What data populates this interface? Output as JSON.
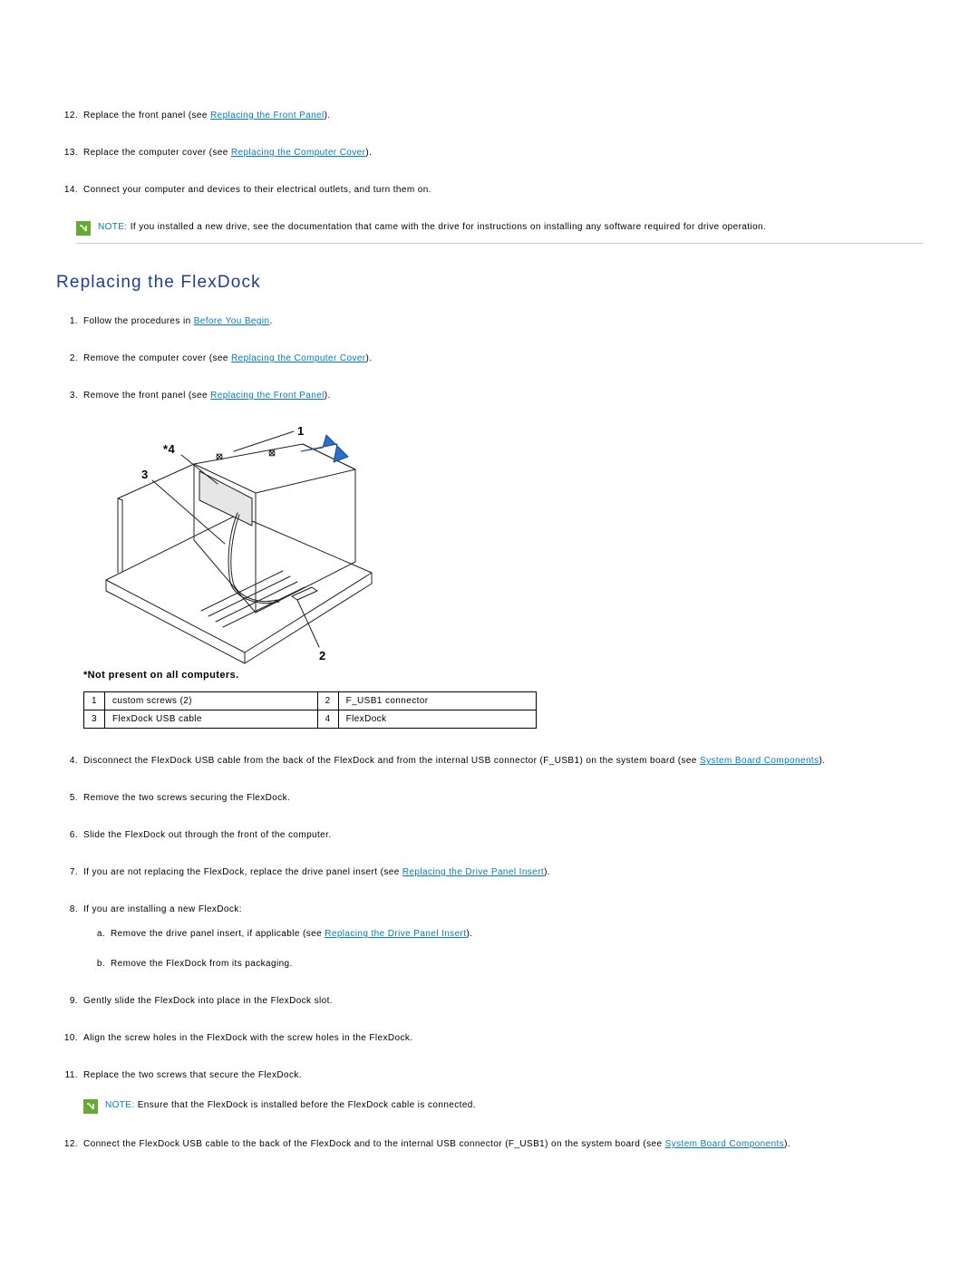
{
  "top_steps": [
    {
      "num": "12.",
      "prefix": "Replace the front panel (see ",
      "link": "Replacing the Front Panel",
      "suffix": ")."
    },
    {
      "num": "13.",
      "prefix": "Replace the computer cover (see ",
      "link": "Replacing the Computer Cover",
      "suffix": ")."
    },
    {
      "num": "14.",
      "prefix": "Connect your computer and devices to their electrical outlets, and turn them on."
    }
  ],
  "note1": {
    "label": "NOTE:",
    "text": " If you installed a new drive, see the documentation that came with the drive for instructions on installing any software required for drive operation."
  },
  "section_title": "Replacing the FlexDock",
  "steps_a": [
    {
      "num": "1.",
      "prefix": "Follow the procedures in ",
      "link": "Before You Begin",
      "suffix": "."
    },
    {
      "num": "2.",
      "prefix": "Remove the computer cover (see ",
      "link": "Replacing the Computer Cover",
      "suffix": ")."
    },
    {
      "num": "3.",
      "prefix": "Remove the front panel (see ",
      "link": "Replacing the Front Panel",
      "suffix": ")."
    }
  ],
  "diagram_labels": {
    "l1": "1",
    "l2": "2",
    "l3": "3",
    "l4": "*4"
  },
  "diagram_caption": "*Not present on all computers.",
  "parts_table": [
    [
      "1",
      "custom screws (2)",
      "2",
      "F_USB1 connector"
    ],
    [
      "3",
      "FlexDock USB cable",
      "4",
      "FlexDock"
    ]
  ],
  "steps_b": [
    {
      "num": "4.",
      "prefix": "Disconnect the FlexDock USB cable from the back of the FlexDock and from the internal USB connector (F_USB1) on the system board (see ",
      "link": "System Board Components",
      "suffix": ")."
    },
    {
      "num": "5.",
      "prefix": "Remove the two screws securing the FlexDock."
    },
    {
      "num": "6.",
      "prefix": "Slide the FlexDock out through the front of the computer."
    },
    {
      "num": "7.",
      "prefix": "If you are not replacing the FlexDock, replace the drive panel insert (see ",
      "link": "Replacing the Drive Panel Insert",
      "suffix": ")."
    },
    {
      "num": "8.",
      "prefix": "If you are installing a new FlexDock:",
      "sub": [
        {
          "subnum": "a.",
          "prefix": "Remove the drive panel insert, if applicable (see ",
          "link": "Replacing the Drive Panel Insert",
          "suffix": ")."
        },
        {
          "subnum": "b.",
          "prefix": "Remove the FlexDock from its packaging."
        }
      ]
    },
    {
      "num": "9.",
      "prefix": "Gently slide the FlexDock into place in the FlexDock slot."
    },
    {
      "num": "10.",
      "prefix": "Align the screw holes in the FlexDock with the screw holes in the FlexDock."
    },
    {
      "num": "11.",
      "prefix": "Replace the two screws that secure the FlexDock.",
      "note": {
        "label": "NOTE:",
        "text": " Ensure that the FlexDock is installed before the FlexDock cable is connected."
      }
    },
    {
      "num": "12.",
      "prefix": "Connect the FlexDock USB cable to the back of the FlexDock and to the internal USB connector (F_USB1) on the system board (see ",
      "link": "System Board Components",
      "suffix": ")."
    }
  ]
}
